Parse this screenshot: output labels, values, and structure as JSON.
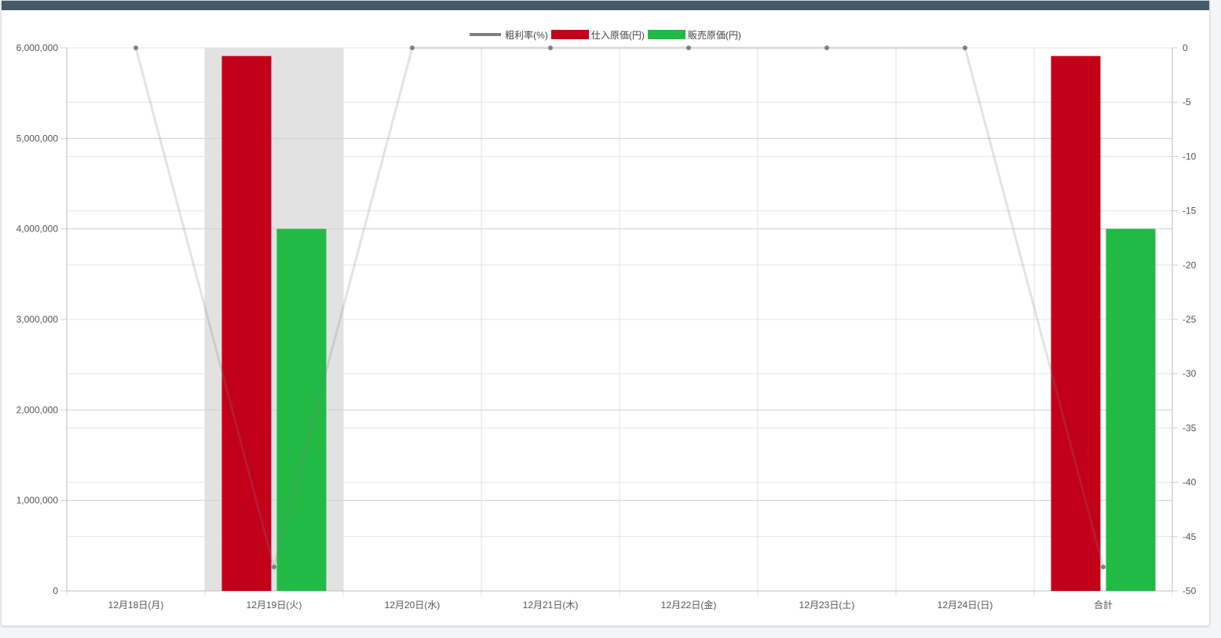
{
  "colors": {
    "header_bar": "#455a66",
    "gross_margin": "#808080",
    "purchase_cost": "#c3001a",
    "sales_cost": "#22b945",
    "highlight_band": "#e2e2e2"
  },
  "chart_data": {
    "type": "bar",
    "categories": [
      "12月18日(月)",
      "12月19日(火)",
      "12月20日(水)",
      "12月21日(木)",
      "12月22日(金)",
      "12月23日(土)",
      "12月24日(日)",
      "合計"
    ],
    "highlighted_category": "12月19日(火)",
    "series": [
      {
        "name": "粗利率(%)",
        "type": "line",
        "axis": "right",
        "values": [
          0,
          -47.8,
          0,
          0,
          0,
          0,
          0,
          -47.8
        ]
      },
      {
        "name": "仕入原価(円)",
        "type": "bar",
        "axis": "left",
        "values": [
          0,
          5910000,
          0,
          0,
          0,
          0,
          0,
          5910000
        ]
      },
      {
        "name": "販売原価(円)",
        "type": "bar",
        "axis": "left",
        "values": [
          0,
          4000000,
          0,
          0,
          0,
          0,
          0,
          4000000
        ]
      }
    ],
    "y_left": {
      "range": [
        0,
        6000000
      ],
      "ticks": [
        0,
        1000000,
        2000000,
        3000000,
        4000000,
        5000000,
        6000000
      ],
      "tick_labels": [
        "0",
        "1,000,000",
        "2,000,000",
        "3,000,000",
        "4,000,000",
        "5,000,000",
        "6,000,000"
      ]
    },
    "y_right": {
      "range": [
        -50,
        0
      ],
      "ticks": [
        -50,
        -45,
        -40,
        -35,
        -30,
        -25,
        -20,
        -15,
        -10,
        -5,
        0
      ],
      "tick_labels": [
        "-50",
        "-45",
        "-40",
        "-35",
        "-30",
        "-25",
        "-20",
        "-15",
        "-10",
        "-5",
        "0"
      ]
    },
    "legend_position": "top-center",
    "grid": true
  }
}
